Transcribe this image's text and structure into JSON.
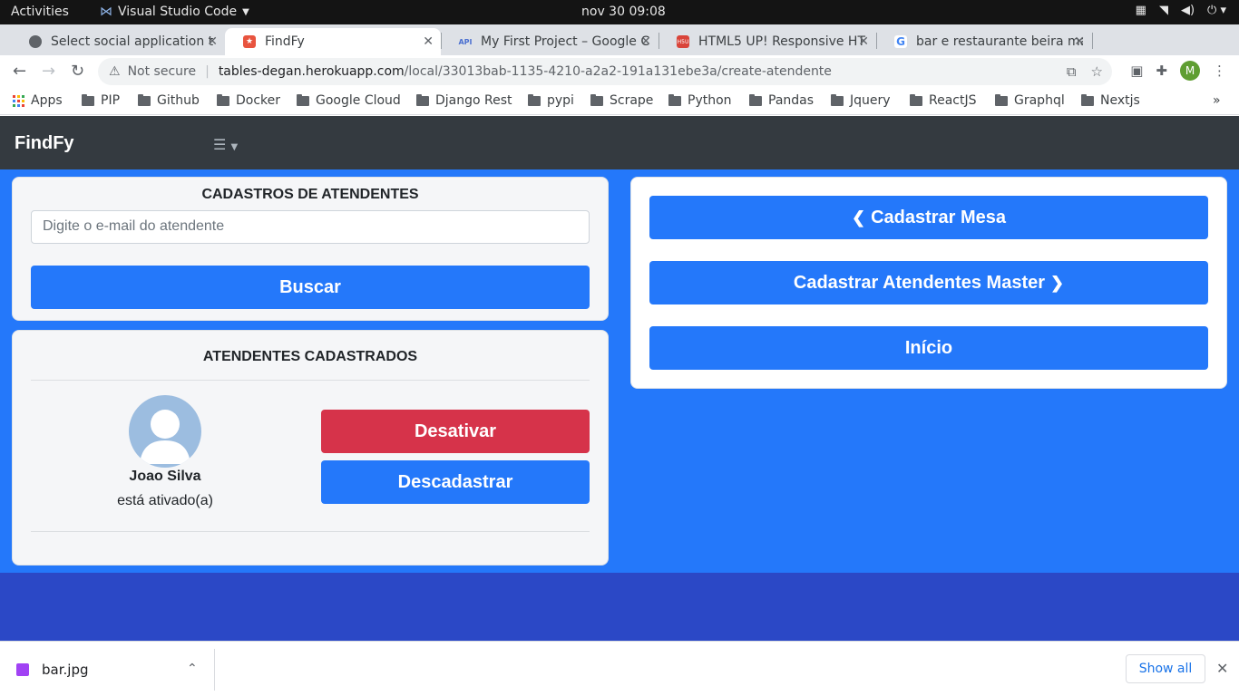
{
  "os": {
    "activities": "Activities",
    "app_name": "Visual Studio Code",
    "clock": "nov 30  09:08"
  },
  "tabs": [
    {
      "title": "Select social application t",
      "favicon_color": "#5f6368"
    },
    {
      "title": "FindFy",
      "favicon_color": "#e8543f"
    },
    {
      "title": "My First Project – Google C",
      "favicon_color": "#4a6fd0"
    },
    {
      "title": "HTML5 UP! Responsive HT",
      "favicon_color": "#d9443a"
    },
    {
      "title": "bar e restaurante beira ma",
      "favicon_color": "#4285f4"
    }
  ],
  "address": {
    "security": "Not secure",
    "host": "tables-degan.herokuapp.com",
    "path": "/local/33013bab-1135-4210-a2a2-191a131ebe3a/create-atendente",
    "profile_initial": "M"
  },
  "bookmarks": {
    "apps": "Apps",
    "folders": [
      "PIP",
      "Github",
      "Docker",
      "Google Cloud",
      "Django Rest",
      "pypi",
      "Scrape",
      "Python",
      "Pandas",
      "Jquery",
      "ReactJS",
      "Graphql",
      "Nextjs"
    ],
    "more": "»"
  },
  "navbar": {
    "brand": "FindFy",
    "menu_icon": "hamburger-icon"
  },
  "search_card": {
    "title": "CADASTROS DE ATENDENTES",
    "email_placeholder": "Digite o e-mail do atendente",
    "search_button": "Buscar"
  },
  "list_card": {
    "title": "ATENDENTES CADASTRADOS",
    "attendant": {
      "name": "Joao Silva",
      "status": "está ativado(a)",
      "deactivate_button": "Desativar",
      "unregister_button": "Descadastrar"
    }
  },
  "nav_card": {
    "register_table": "Cadastrar Mesa",
    "register_masters": "Cadastrar Atendentes Master",
    "home": "Início"
  },
  "downloads": {
    "file": "bar.jpg",
    "show_all": "Show all"
  },
  "colors": {
    "primary": "#2478fa",
    "danger": "#d6334a",
    "navbar": "#343a40",
    "footer": "#2b48c6"
  }
}
